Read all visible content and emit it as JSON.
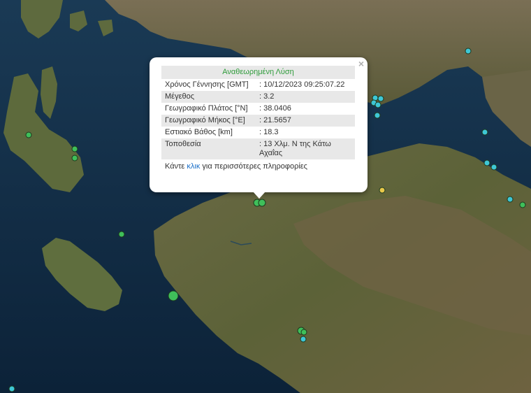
{
  "popup": {
    "title": "Αναθεωρημένη Λύση",
    "close_symbol": "×",
    "rows": [
      {
        "label": "Χρόνος Γέννησης [GMT]",
        "value": ": 10/12/2023 09:25:07.22"
      },
      {
        "label": "Μέγεθος",
        "value": ": 3.2"
      },
      {
        "label": "Γεωγραφικό Πλάτος [°N]",
        "value": ": 38.0406"
      },
      {
        "label": "Γεωγραφικό Μήκος [°E]",
        "value": ": 21.5657"
      },
      {
        "label": "Εστιακό Βάθος [km]",
        "value": ": 18.3"
      },
      {
        "label": "Τοποθεσία",
        "value": ": 13 Χλμ. Ν της Κάτω Αχαΐας"
      }
    ],
    "more_prefix": "Κάντε ",
    "more_link": "κλικ",
    "more_suffix": " για περισσότερες πληροφορίες"
  },
  "colors": {
    "sea": "#0f2a44",
    "land": "#5a6238",
    "green_marker": "#3fbf5a",
    "cyan_marker": "#3ec7d6",
    "yellow_marker": "#e8c84a",
    "title_green": "#2e9b3a",
    "link_blue": "#1a6fc9"
  },
  "icons": {
    "close": "close-icon"
  },
  "markers": [
    {
      "type": "green"
    },
    {
      "type": "green"
    },
    {
      "type": "green"
    },
    {
      "type": "green"
    },
    {
      "type": "green"
    },
    {
      "type": "green"
    },
    {
      "type": "green"
    },
    {
      "type": "green"
    },
    {
      "type": "cyan"
    },
    {
      "type": "cyan"
    },
    {
      "type": "cyan"
    },
    {
      "type": "cyan"
    },
    {
      "type": "cyan"
    },
    {
      "type": "cyan"
    },
    {
      "type": "cyan"
    },
    {
      "type": "cyan"
    },
    {
      "type": "cyan"
    },
    {
      "type": "cyan"
    },
    {
      "type": "cyan"
    },
    {
      "type": "cyan"
    },
    {
      "type": "yellow"
    }
  ]
}
